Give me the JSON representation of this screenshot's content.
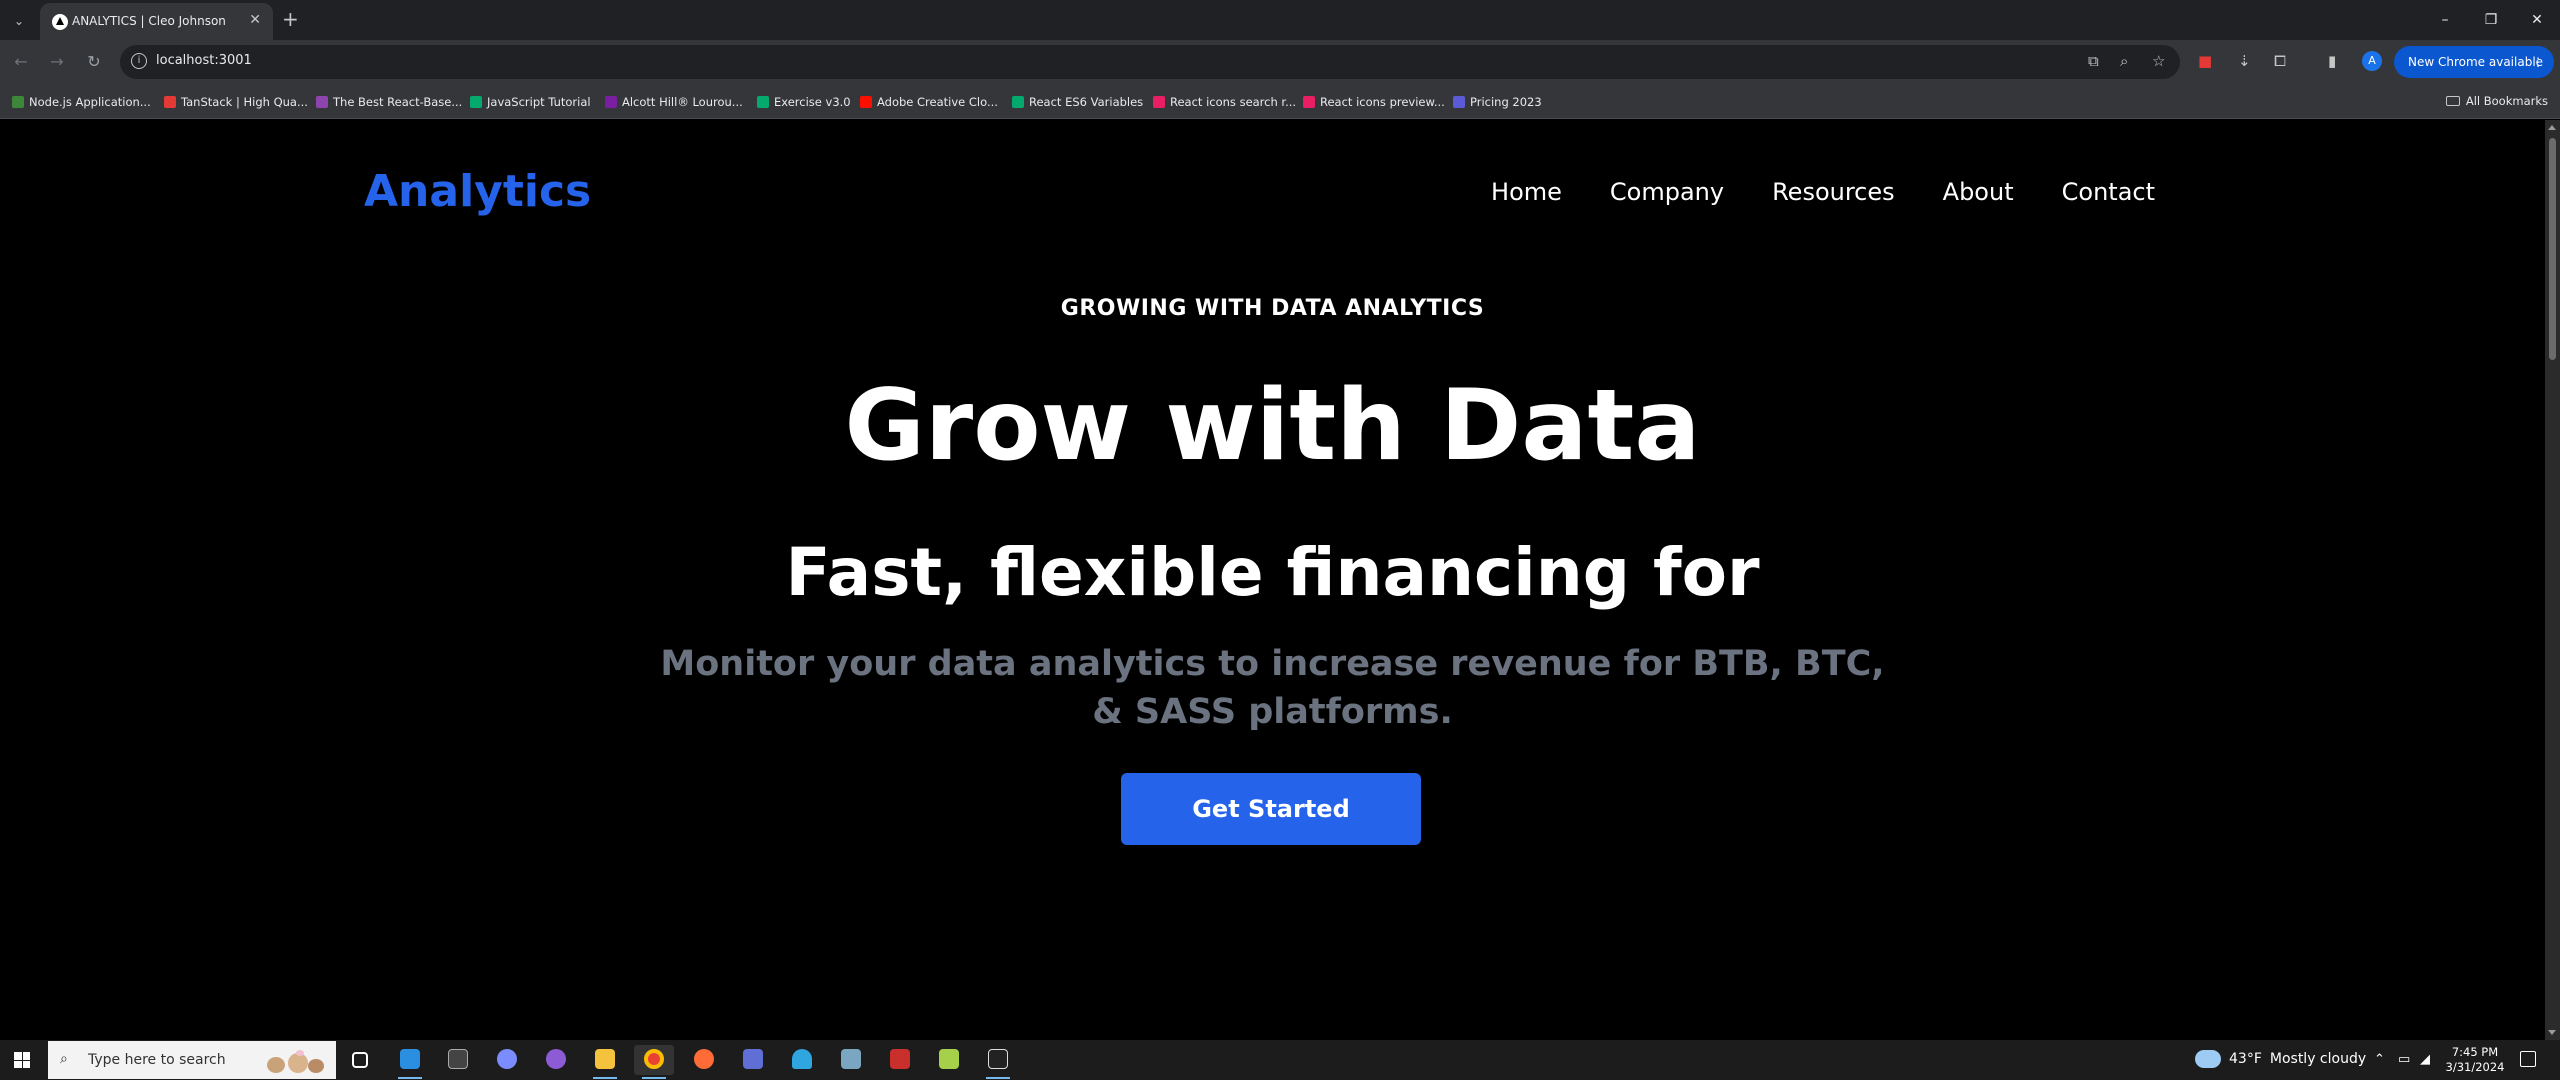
{
  "browser": {
    "tab_title": "ANALYTICS | Cleo Johnson",
    "url": "localhost:3001",
    "update_label": "New Chrome available",
    "profile_initial": "A",
    "all_bookmarks_label": "All Bookmarks",
    "bookmarks": [
      {
        "label": "Node.js Application...",
        "color": "#3c873a"
      },
      {
        "label": "TanStack | High Qua...",
        "color": "#e53935"
      },
      {
        "label": "The Best React-Base...",
        "color": "#8e44ad"
      },
      {
        "label": "JavaScript Tutorial",
        "color": "#04aa6d"
      },
      {
        "label": "Alcott Hill® Lourou...",
        "color": "#7b1fa2"
      },
      {
        "label": "Exercise v3.0",
        "color": "#04aa6d"
      },
      {
        "label": "Adobe Creative Clo...",
        "color": "#fa0f00"
      },
      {
        "label": "React ES6 Variables",
        "color": "#04aa6d"
      },
      {
        "label": "React icons search r...",
        "color": "#e91e63"
      },
      {
        "label": "React icons preview...",
        "color": "#e91e63"
      },
      {
        "label": "Pricing 2023",
        "color": "#5b5bd6"
      }
    ]
  },
  "page": {
    "logo": "Analytics",
    "nav": [
      "Home",
      "Company",
      "Resources",
      "About",
      "Contact"
    ],
    "eyebrow": "GROWING WITH DATA ANALYTICS",
    "title": "Grow with Data",
    "subtitle": "Fast, flexible financing for",
    "description": "Monitor your data analytics to increase revenue for BTB, BTC, & SASS platforms.",
    "cta": "Get Started",
    "accent_color": "#2563eb"
  },
  "taskbar": {
    "search_placeholder": "Type here to search",
    "temperature": "43°F",
    "weather": "Mostly cloudy",
    "time": "7:45 PM",
    "date": "3/31/2024"
  }
}
